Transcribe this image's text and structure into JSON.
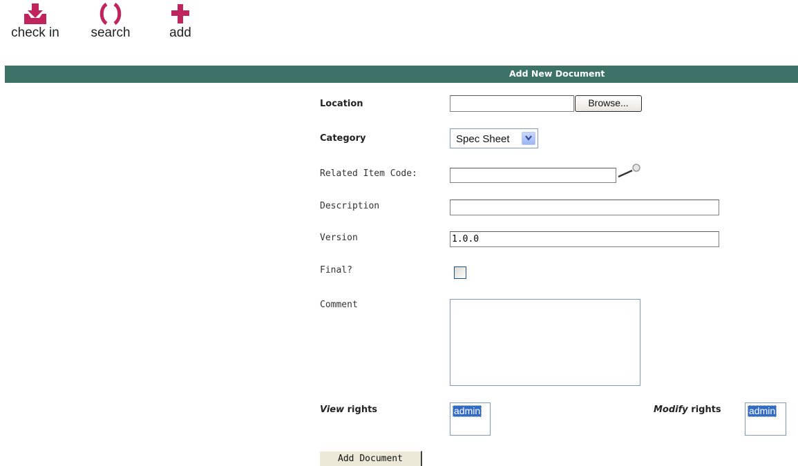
{
  "toolbar": {
    "check_in": {
      "label": "check in",
      "icon": "check-in-tray-icon",
      "color": "#c0245c"
    },
    "search": {
      "label": "search",
      "icon": "parentheses-search-icon",
      "color": "#c0245c"
    },
    "add": {
      "label": "add",
      "icon": "plus-icon",
      "color": "#c0245c"
    }
  },
  "header": {
    "title": "Add New Document",
    "background": "#3d7268"
  },
  "form": {
    "location": {
      "label": "Location",
      "value": "",
      "browse_label": "Browse..."
    },
    "category": {
      "label": "Category",
      "selected": "Spec Sheet"
    },
    "related_item_code": {
      "label": "Related Item Code:",
      "value": "",
      "lookup_icon": "magnifier-icon"
    },
    "description": {
      "label": "Description",
      "value": ""
    },
    "version": {
      "label": "Version",
      "value": "1.0.0"
    },
    "final": {
      "label": "Final?",
      "checked": false
    },
    "comment": {
      "label": "Comment",
      "value": ""
    },
    "view_rights": {
      "label_emphasis": "View",
      "label_rest": " rights",
      "options": [
        "admin"
      ],
      "selected": "admin"
    },
    "modify_rights": {
      "label_emphasis": "Modify",
      "label_rest": " rights",
      "options": [
        "admin"
      ],
      "selected": "admin"
    },
    "submit_label": "Add Document"
  }
}
